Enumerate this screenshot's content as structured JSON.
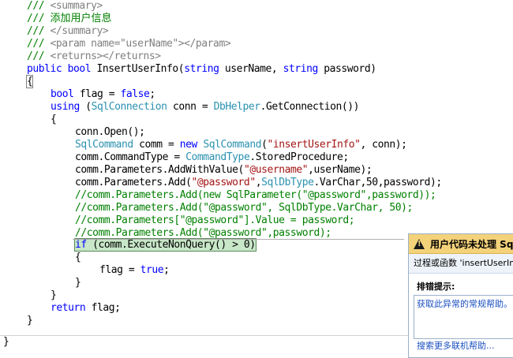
{
  "code_lines": [
    {
      "id": "l1",
      "tokens": [
        {
          "t": "/// ",
          "c": "comment"
        },
        {
          "t": "<summary>",
          "c": "doc"
        }
      ]
    },
    {
      "id": "l2",
      "tokens": [
        {
          "t": "/// ",
          "c": "comment"
        },
        {
          "t": "添加用户信息",
          "c": "comment",
          "cjk": true
        }
      ]
    },
    {
      "id": "l3",
      "tokens": [
        {
          "t": "/// ",
          "c": "comment"
        },
        {
          "t": "</summary>",
          "c": "doc"
        }
      ]
    },
    {
      "id": "l4",
      "tokens": [
        {
          "t": "/// ",
          "c": "comment"
        },
        {
          "t": "<param name=\"userName\"></param>",
          "c": "doc"
        }
      ]
    },
    {
      "id": "l5",
      "tokens": [
        {
          "t": "/// ",
          "c": "comment"
        },
        {
          "t": "<returns></returns>",
          "c": "doc"
        }
      ]
    },
    {
      "id": "l6",
      "tokens": [
        {
          "t": "public bool ",
          "c": "kw"
        },
        {
          "t": "InsertUserInfo(",
          "c": "plain"
        },
        {
          "t": "string ",
          "c": "kw"
        },
        {
          "t": "userName, ",
          "c": "plain"
        },
        {
          "t": "string ",
          "c": "kw"
        },
        {
          "t": "password)",
          "c": "plain"
        }
      ]
    },
    {
      "id": "l7",
      "tokens": [
        {
          "t": "{",
          "c": "plain",
          "box": true
        }
      ]
    },
    {
      "id": "l8",
      "tokens": [
        {
          "t": "bool ",
          "c": "kw"
        },
        {
          "t": "flag = ",
          "c": "plain"
        },
        {
          "t": "false",
          "c": "kw"
        },
        {
          "t": ";",
          "c": "plain"
        }
      ]
    },
    {
      "id": "l9",
      "tokens": [
        {
          "t": "using ",
          "c": "kw"
        },
        {
          "t": "(",
          "c": "plain"
        },
        {
          "t": "SqlConnection ",
          "c": "type"
        },
        {
          "t": "conn = ",
          "c": "plain"
        },
        {
          "t": "DbHelper",
          "c": "type"
        },
        {
          "t": ".GetConnection())",
          "c": "plain"
        }
      ]
    },
    {
      "id": "l10",
      "tokens": [
        {
          "t": "{",
          "c": "plain"
        }
      ]
    },
    {
      "id": "l11",
      "tokens": [
        {
          "t": "conn.Open();",
          "c": "plain"
        }
      ]
    },
    {
      "id": "l12",
      "tokens": [
        {
          "t": "SqlCommand ",
          "c": "type"
        },
        {
          "t": "comm = ",
          "c": "plain"
        },
        {
          "t": "new ",
          "c": "kw"
        },
        {
          "t": "SqlCommand",
          "c": "type"
        },
        {
          "t": "(",
          "c": "plain"
        },
        {
          "t": "\"insertUserInfo\"",
          "c": "str"
        },
        {
          "t": ", conn);",
          "c": "plain"
        }
      ]
    },
    {
      "id": "l13",
      "tokens": [
        {
          "t": "comm.CommandType = ",
          "c": "plain"
        },
        {
          "t": "CommandType",
          "c": "type"
        },
        {
          "t": ".StoredProcedure;",
          "c": "plain"
        }
      ]
    },
    {
      "id": "l14",
      "tokens": [
        {
          "t": "comm.Parameters.AddWithValue(",
          "c": "plain"
        },
        {
          "t": "\"@username\"",
          "c": "str"
        },
        {
          "t": ",userName);",
          "c": "plain"
        }
      ]
    },
    {
      "id": "l15",
      "tokens": [
        {
          "t": "comm.Parameters.Add(",
          "c": "plain"
        },
        {
          "t": "\"@password\"",
          "c": "str"
        },
        {
          "t": ",",
          "c": "plain"
        },
        {
          "t": "SqlDbType",
          "c": "type"
        },
        {
          "t": ".VarChar,50,password);",
          "c": "plain"
        }
      ]
    },
    {
      "id": "l16",
      "tokens": [
        {
          "t": "//comm.Parameters.Add(new SqlParameter(\"@password\",password));",
          "c": "comment"
        }
      ]
    },
    {
      "id": "l17",
      "tokens": [
        {
          "t": "//comm.Parameters.Add(\"@password\", SqlDbType.VarChar, 50);",
          "c": "comment"
        }
      ]
    },
    {
      "id": "l18",
      "tokens": [
        {
          "t": "//comm.Parameters[\"@password\"].Value = password;",
          "c": "comment"
        }
      ]
    },
    {
      "id": "l19",
      "tokens": [
        {
          "t": "//comm.Parameters.Add(\"@password\",password);",
          "c": "comment"
        }
      ]
    },
    {
      "id": "l20",
      "tokens": [
        {
          "t": "if ",
          "c": "kw"
        },
        {
          "t": "(comm.ExecuteNonQuery() > 0)",
          "c": "plain"
        }
      ],
      "highlight": true
    },
    {
      "id": "l21",
      "tokens": [
        {
          "t": "{",
          "c": "plain"
        }
      ]
    },
    {
      "id": "l22",
      "tokens": [
        {
          "t": "flag = ",
          "c": "plain"
        },
        {
          "t": "true",
          "c": "kw"
        },
        {
          "t": ";",
          "c": "plain"
        }
      ]
    },
    {
      "id": "l23",
      "tokens": [
        {
          "t": "}",
          "c": "plain"
        }
      ]
    },
    {
      "id": "l24",
      "tokens": [
        {
          "t": "}",
          "c": "plain"
        }
      ]
    },
    {
      "id": "l25",
      "tokens": [
        {
          "t": "return ",
          "c": "kw"
        },
        {
          "t": "flag;",
          "c": "plain"
        }
      ]
    },
    {
      "id": "l26",
      "tokens": [
        {
          "t": "}",
          "c": "plain"
        }
      ]
    },
    {
      "id": "l27",
      "tokens": [
        {
          "t": "}",
          "c": "plain"
        }
      ]
    }
  ],
  "exception_popup": {
    "title": "用户代码未处理 Sql",
    "icon": "warning-icon",
    "procedure_text": "过程或函数 'insertUserInfo",
    "tips_title": "排错提示:",
    "tips_text": "获取此异常的常规帮助。",
    "more_help_link": "搜索更多联机帮助..."
  },
  "colors": {
    "comment": "#008000",
    "keyword": "#0000ff",
    "type": "#2b91af",
    "string": "#a31515",
    "highlight": "#c8e6c8",
    "popup_header": "#f4d27a"
  }
}
